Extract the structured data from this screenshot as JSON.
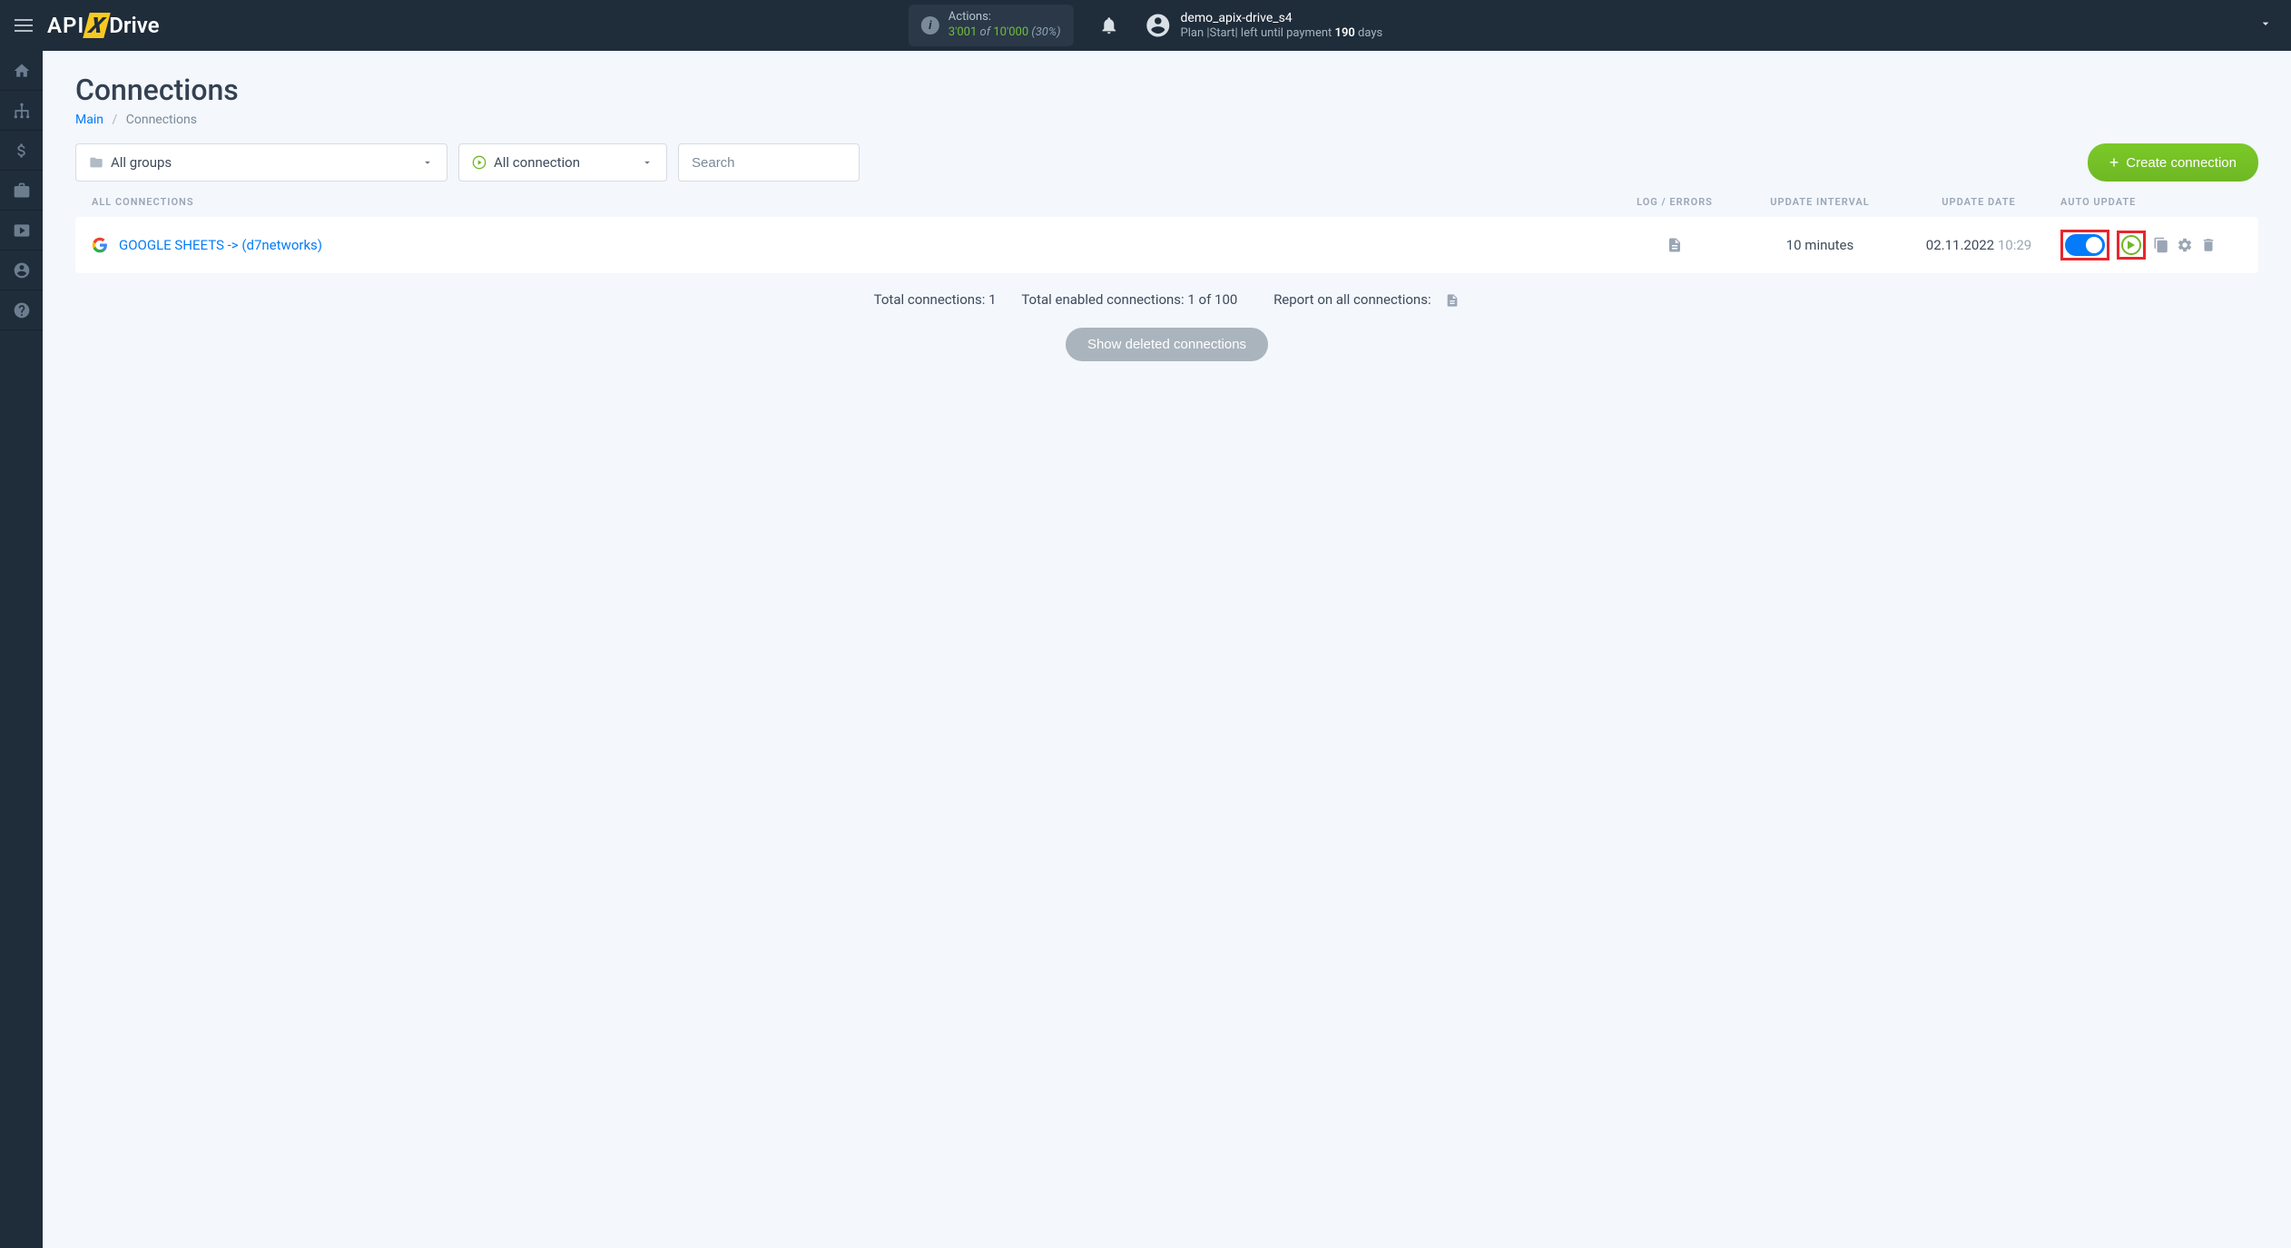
{
  "header": {
    "logo": {
      "prefix": "API",
      "x": "X",
      "suffix": "Drive"
    },
    "actions": {
      "label": "Actions:",
      "used": "3'001",
      "of": "of",
      "total": "10'000",
      "pct": "(30%)"
    },
    "user": {
      "name": "demo_apix-drive_s4",
      "plan_prefix": "Plan |Start| left until payment ",
      "days": "190",
      "days_suffix": " days"
    }
  },
  "page": {
    "title": "Connections",
    "breadcrumb": {
      "main": "Main",
      "current": "Connections"
    }
  },
  "filters": {
    "groups": "All groups",
    "status": "All connection",
    "search_placeholder": "Search",
    "create_btn": "Create connection"
  },
  "table": {
    "headers": {
      "all": "ALL CONNECTIONS",
      "log": "LOG / ERRORS",
      "interval": "UPDATE INTERVAL",
      "date": "UPDATE DATE",
      "auto": "AUTO UPDATE"
    },
    "rows": [
      {
        "name": "GOOGLE SHEETS -> (d7networks)",
        "interval": "10 minutes",
        "date": "02.11.2022",
        "time": "10:29"
      }
    ]
  },
  "summary": {
    "total": "Total connections: 1",
    "enabled": "Total enabled connections: 1 of 100",
    "report": "Report on all connections:"
  },
  "buttons": {
    "show_deleted": "Show deleted connections"
  }
}
